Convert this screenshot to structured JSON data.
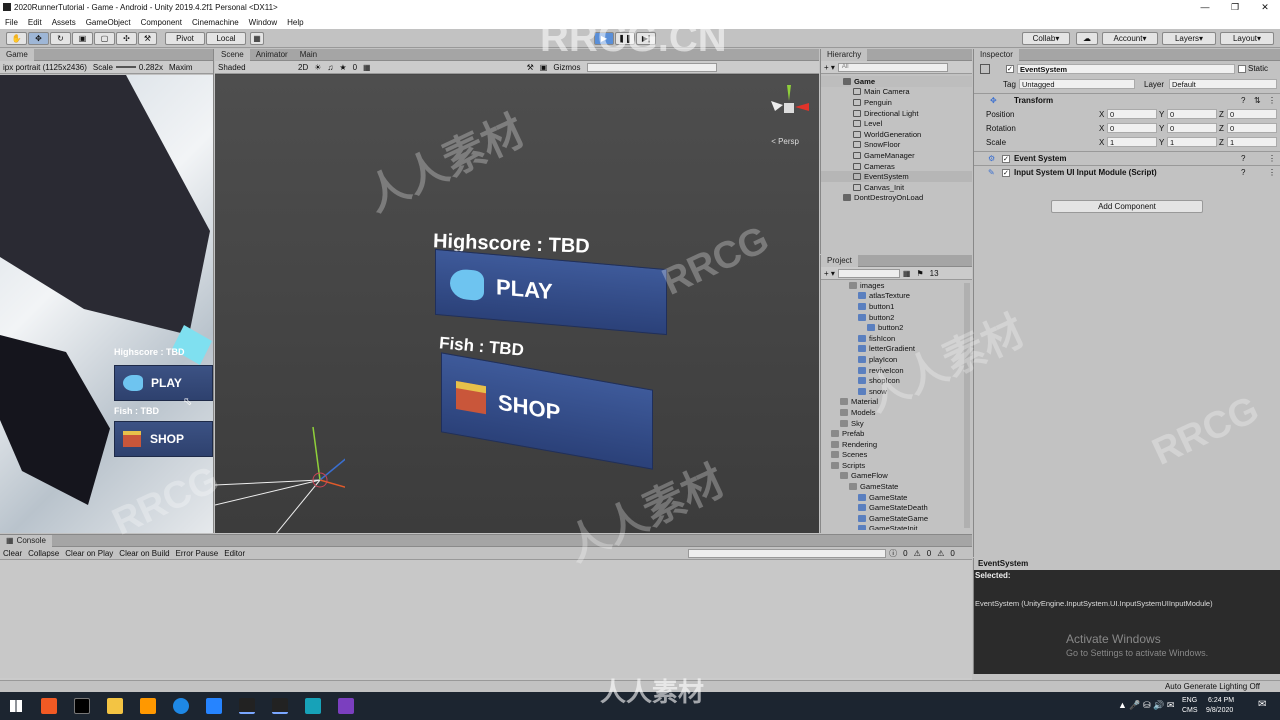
{
  "window": {
    "title": "2020RunnerTutorial - Game - Android - Unity 2019.4.2f1 Personal <DX11>"
  },
  "menu": [
    "File",
    "Edit",
    "Assets",
    "GameObject",
    "Component",
    "Cinemachine",
    "Window",
    "Help"
  ],
  "toolbar": {
    "pivot": "Pivot",
    "local": "Local",
    "collab": "Collab",
    "account": "Account",
    "layers": "Layers",
    "layout": "Layout"
  },
  "game_view": {
    "tab": "Game",
    "resolution": "ipx portrait (1125x2436)",
    "scale_label": "Scale",
    "scale_value": "0.282x",
    "maximize": "Maxim",
    "highscore": "Highscore : TBD",
    "play": "PLAY",
    "fish": "Fish : TBD",
    "shop": "SHOP"
  },
  "scene_view": {
    "tabs": [
      "Scene",
      "Animator",
      "Main"
    ],
    "shading": "Shaded",
    "mode_2d": "2D",
    "gizmos": "Gizmos",
    "search_placeholder": "All",
    "persp": "< Persp",
    "highscore": "Highscore : TBD",
    "play": "PLAY",
    "fish": "Fish : TBD",
    "shop": "SHOP",
    "fx_count": "0"
  },
  "hierarchy": {
    "tab": "Hierarchy",
    "search_placeholder": "All",
    "root": "Game",
    "items": [
      "Main Camera",
      "Penguin",
      "Directional Light",
      "Level",
      "WorldGeneration",
      "SnowFloor",
      "GameManager",
      "Cameras",
      "EventSystem",
      "Canvas_Init"
    ],
    "selected": "EventSystem",
    "dont_destroy": "DontDestroyOnLoad"
  },
  "project": {
    "tab": "Project",
    "count": "13",
    "items": [
      {
        "label": "images",
        "depth": 2
      },
      {
        "label": "atlasTexture",
        "depth": 3
      },
      {
        "label": "button1",
        "depth": 3
      },
      {
        "label": "button2",
        "depth": 3
      },
      {
        "label": "button2",
        "depth": 4
      },
      {
        "label": "fishIcon",
        "depth": 3
      },
      {
        "label": "letterGradient",
        "depth": 3
      },
      {
        "label": "playIcon",
        "depth": 3
      },
      {
        "label": "reviveIcon",
        "depth": 3
      },
      {
        "label": "shopIcon",
        "depth": 3
      },
      {
        "label": "snow",
        "depth": 3
      },
      {
        "label": "Material",
        "depth": 1
      },
      {
        "label": "Models",
        "depth": 1
      },
      {
        "label": "Sky",
        "depth": 1
      },
      {
        "label": "Prefab",
        "depth": 0
      },
      {
        "label": "Rendering",
        "depth": 0
      },
      {
        "label": "Scenes",
        "depth": 0
      },
      {
        "label": "Scripts",
        "depth": 0
      },
      {
        "label": "GameFlow",
        "depth": 1
      },
      {
        "label": "GameState",
        "depth": 2
      },
      {
        "label": "GameState",
        "depth": 3
      },
      {
        "label": "GameStateDeath",
        "depth": 3
      },
      {
        "label": "GameStateGame",
        "depth": 3
      },
      {
        "label": "GameStateInit",
        "depth": 3
      }
    ]
  },
  "inspector": {
    "tab": "Inspector",
    "object_name": "EventSystem",
    "static": "Static",
    "tag_label": "Tag",
    "tag_value": "Untagged",
    "layer_label": "Layer",
    "layer_value": "Default",
    "transform": "Transform",
    "position": "Position",
    "rotation": "Rotation",
    "scale": "Scale",
    "pos": [
      "0",
      "0",
      "0"
    ],
    "rot": [
      "0",
      "0",
      "0"
    ],
    "scl": [
      "1",
      "1",
      "1"
    ],
    "component1": "Event System",
    "component2": "Input System UI Input Module (Script)",
    "add_component": "Add Component",
    "preview_title": "EventSystem",
    "selected_label": "Selected:",
    "selected_text": "EventSystem (UnityEngine.InputSystem.UI.InputSystemUIInputModule)",
    "activate_title": "Activate Windows",
    "activate_sub": "Go to Settings to activate Windows."
  },
  "console": {
    "tab": "Console",
    "buttons": [
      "Clear",
      "Collapse",
      "Clear on Play",
      "Clear on Build",
      "Error Pause",
      "Editor"
    ],
    "counts": [
      "0",
      "0",
      "0"
    ]
  },
  "statusbar": {
    "text": "Auto Generate Lighting Off"
  },
  "taskbar": {
    "lang1": "ENG",
    "lang2": "CMS",
    "time": "6:24 PM",
    "date": "9/8/2020"
  },
  "watermarks": {
    "brand": "RRCG.CN",
    "logo": "RRCG",
    "cn": "人人素材"
  }
}
